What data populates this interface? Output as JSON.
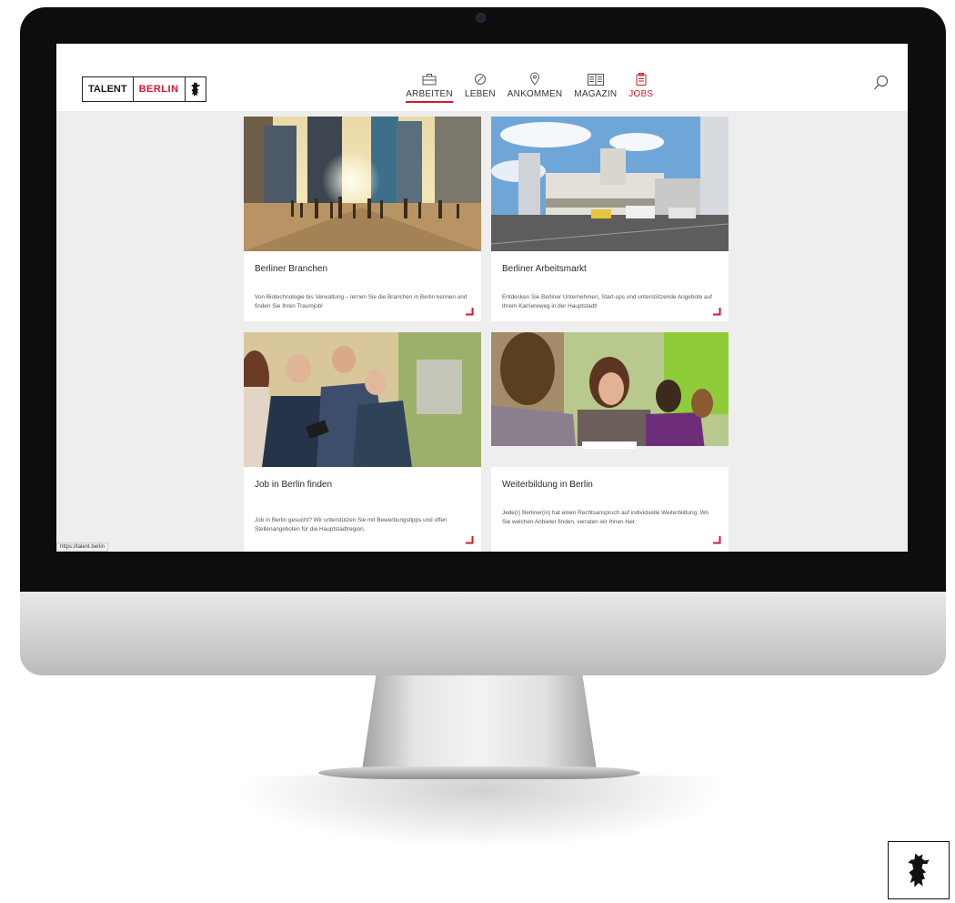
{
  "site": {
    "logo": {
      "talent": "TALENT",
      "berlin": "BERLIN"
    },
    "nav": [
      {
        "label": "ARBEITEN",
        "icon": "briefcase-icon",
        "active": true
      },
      {
        "label": "LEBEN",
        "icon": "compass-icon",
        "active": false
      },
      {
        "label": "ANKOMMEN",
        "icon": "location-pin-icon",
        "active": false
      },
      {
        "label": "MAGAZIN",
        "icon": "newspaper-icon",
        "active": false
      },
      {
        "label": "JOBS",
        "icon": "clipboard-icon",
        "active": false
      }
    ],
    "search_icon": "search-icon",
    "status_url": "https://talent.berlin"
  },
  "cards": [
    {
      "title": "Berliner Branchen",
      "text": "Von Biotechnologie bis Verwaltung – lernen Sie die Branchen in Berlin kennen und finden Sie Ihren Traumjob!"
    },
    {
      "title": "Berliner Arbeitsmarkt",
      "text": "Entdecken Sie Berliner Unternehmen, Start-ups und unterstützende Angebote auf Ihrem Karriereweg in der Hauptstadt!"
    },
    {
      "title": "Job in Berlin finden",
      "text": "Job in Berlin gesucht? Wir unterstützen Sie mit Bewerbungstipps und offen Stellenangeboten für die Hauptstadtregion."
    },
    {
      "title": "Weiterbildung in Berlin",
      "text": "Jede(r) Berliner(in) hat einen Rechtsanspruch auf individuelle Weiterbildung. Wo Sie welchen Anbieter finden, verraten wir Ihnen hier."
    }
  ],
  "colors": {
    "accent": "#d7172f",
    "screen_bg": "#eeeeee",
    "bezel": "#0d0d0d"
  }
}
